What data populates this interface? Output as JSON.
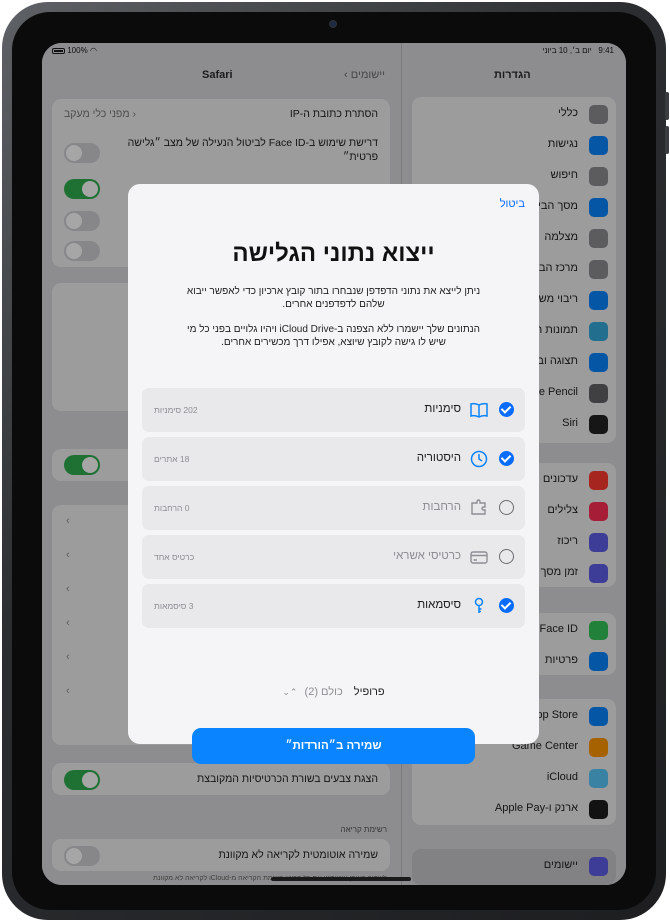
{
  "status_bar": {
    "time": "9:41",
    "date": "יום ב׳, 10 ביוני",
    "battery": "100%"
  },
  "safari_pane": {
    "title": "Safari",
    "back_label": "יישומים",
    "rows": {
      "hide_ip": "הסתרת כתובת ה-IP",
      "hide_ip_value": "מפני כלי מעקב",
      "faceid_lock": "דרישת שימוש ב-Face ID לביטול הנעילה של מצב ״גלישה פרטית״",
      "tab_colors": "הצגת צבעים בשורת הכרטיסיות המקובצת",
      "reading_list_header": "רשימת קריאה",
      "auto_save_offline": "שמירה אוטומטית לקריאה לא מקוונת",
      "footer_text": "לשמור באופן אוטומטי את כל פריטי רשימת הקריאה מ-iCloud לקריאה לא מקוונת"
    }
  },
  "settings_pane": {
    "title": "הגדרות",
    "group1": [
      "כללי",
      "נגישות",
      "חיפוש",
      "מסך הבית",
      "מצלמה",
      "מרכז הבקרה",
      "ריבוי משימות",
      "תמונות רקע",
      "תצוגה ובהירות",
      "Apple Pencil",
      "Siri"
    ],
    "group2": [
      "עדכונים",
      "צלילים",
      "ריכוז",
      "זמן מסך"
    ],
    "group3": [
      "Face ID",
      "פרטיות"
    ],
    "group4": [
      "App Store",
      "Game Center",
      "iCloud",
      "ארנק ו-Apple Pay"
    ],
    "group5": [
      "יישומים"
    ]
  },
  "modal": {
    "cancel_label": "ביטול",
    "title": "ייצוא נתוני הגלישה",
    "description_1": "ניתן לייצא את נתוני הדפדפן שנבחרו בתור קובץ ארכיון כדי לאפשר ייבוא שלהם לדפדפנים אחרים.",
    "description_2": "הנתונים שלך יישמרו ללא הצפנה ב-iCloud Drive ויהיו גלויים בפני כל מי שיש לו גישה לקובץ שיוצא, אפילו דרך מכשירים אחרים.",
    "options": [
      {
        "label": "סימניות",
        "count": "202 סימניות",
        "checked": true,
        "icon": "book-icon"
      },
      {
        "label": "היסטוריה",
        "count": "18 אתרים",
        "checked": true,
        "icon": "clock-icon"
      },
      {
        "label": "הרחבות",
        "count": "0 הרחבות",
        "checked": false,
        "icon": "extension-icon"
      },
      {
        "label": "כרטיסי אשראי",
        "count": "כרטיס אחד",
        "checked": false,
        "icon": "credit-card-icon"
      },
      {
        "label": "סיסמאות",
        "count": "3 סיסמאות",
        "checked": true,
        "icon": "key-icon"
      }
    ],
    "profile_label": "פרופיל",
    "profile_value": "כולם (2)",
    "save_button": "שמירה ב״הורדות״"
  },
  "colors": {
    "accent": "#0A84FF",
    "toggle_on": "#2FAE4E"
  }
}
